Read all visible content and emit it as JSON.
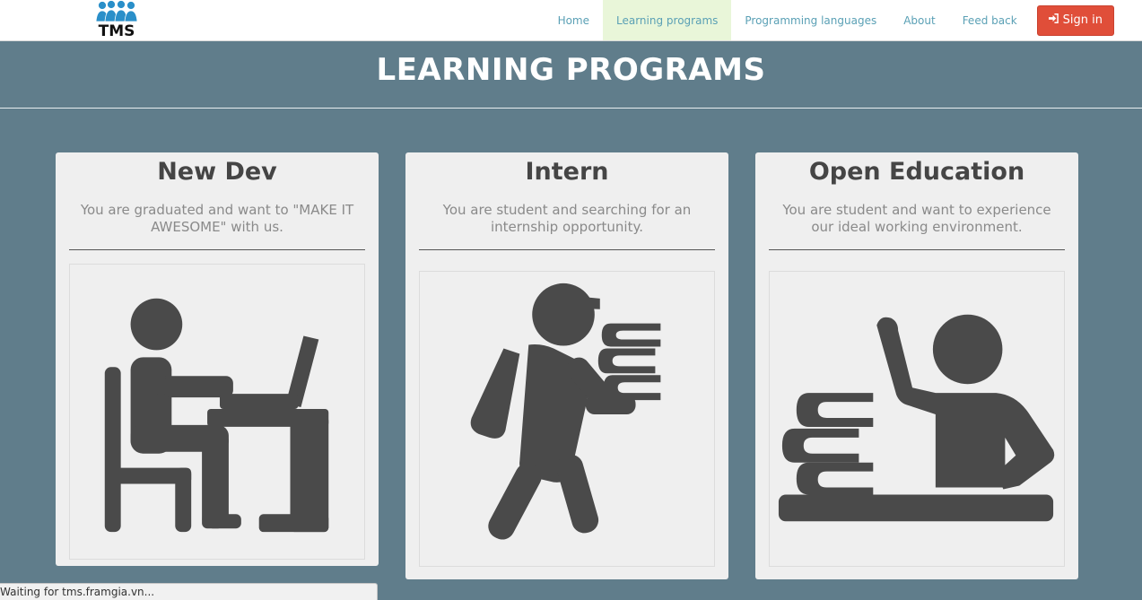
{
  "logo": {
    "text": "TMS",
    "icon": "tms-people-logo"
  },
  "nav": {
    "items": [
      {
        "label": "Home"
      },
      {
        "label": "Learning programs",
        "active": true
      },
      {
        "label": "Programming languages"
      },
      {
        "label": "About"
      },
      {
        "label": "Feed back"
      }
    ],
    "signin": {
      "label": "Sign in",
      "icon": "sign-in-icon",
      "color": "#e04e39"
    }
  },
  "page": {
    "title": "LEARNING PROGRAMS"
  },
  "programs": [
    {
      "title": "New Dev",
      "description": "You are graduated and want to \"MAKE IT AWESOME\" with us.",
      "icon": "developer-at-desk-icon"
    },
    {
      "title": "Intern",
      "description": "You are student and searching for an internship opportunity.",
      "icon": "student-carrying-books-icon"
    },
    {
      "title": "Open Education",
      "description": "You are student and want to experience our ideal working environment.",
      "icon": "student-raising-hand-icon"
    }
  ],
  "status": {
    "text": "Waiting for tms.framgia.vn..."
  },
  "colors": {
    "background": "#607d8b",
    "card": "#efefef",
    "icon": "#4a4a4a",
    "nav_link": "#5aa0b5",
    "nav_active_bg": "#e9f6d9"
  }
}
